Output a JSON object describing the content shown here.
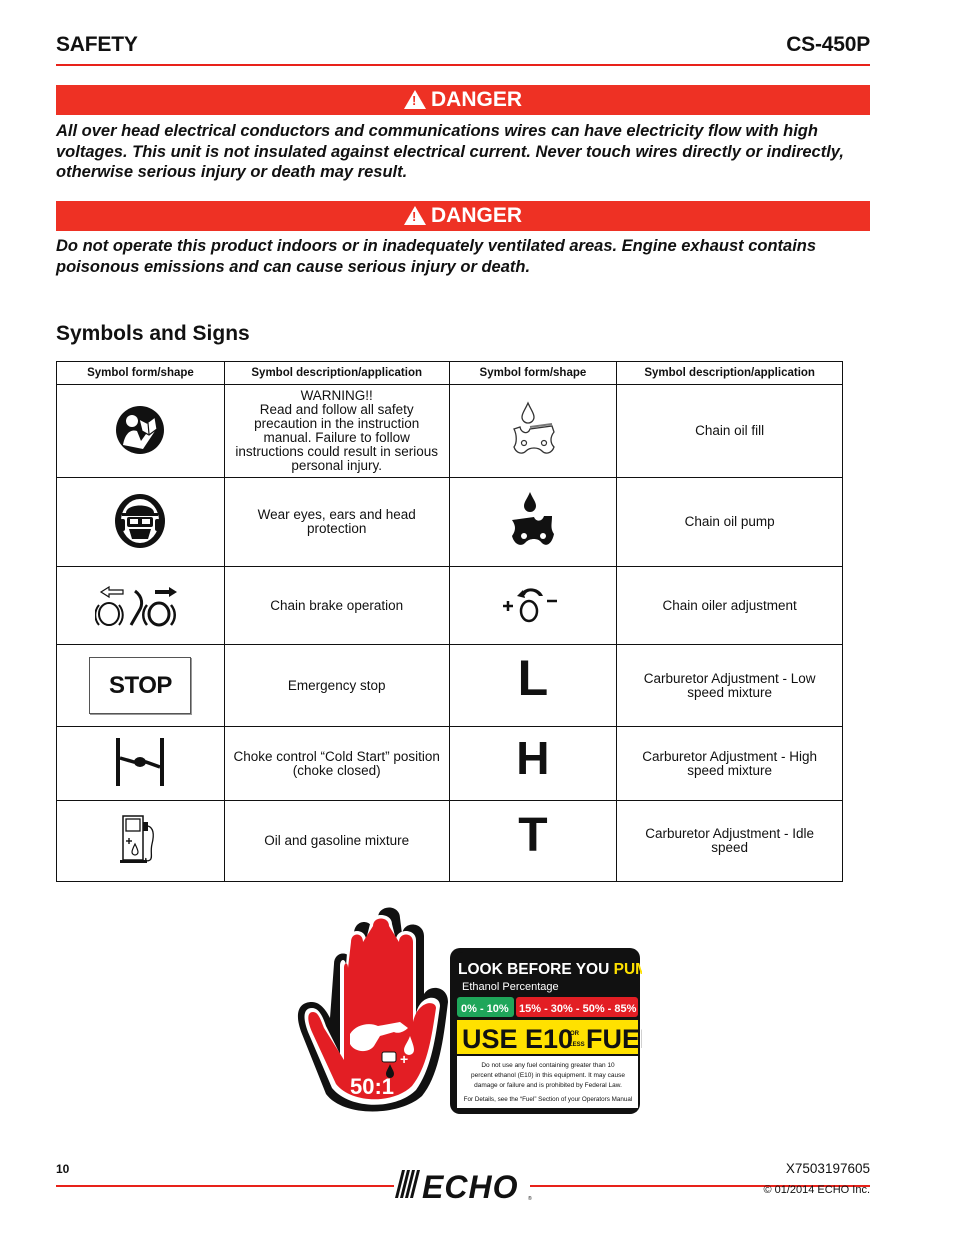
{
  "header": {
    "section": "SAFETY",
    "model": "CS-450P"
  },
  "dangers": [
    {
      "label": "DANGER",
      "text": "All over head electrical conductors and communications wires can have electricity flow with high voltages. This unit is not insulated against electrical current. Never touch wires directly or indirectly, otherwise serious injury or death may result."
    },
    {
      "label": "DANGER",
      "text": "Do not operate this product indoors or in inadequately ventilated areas. Engine exhaust contains poisonous emissions and can cause serious injury or death."
    }
  ],
  "symbols_section": {
    "title": "Symbols and Signs",
    "columns": [
      "Symbol form/shape",
      "Symbol description/application",
      "Symbol form/shape",
      "Symbol description/application"
    ],
    "rows": [
      {
        "left": {
          "icon": "read-manual-icon",
          "desc": [
            "WARNING!!",
            "Read and follow all safety",
            "precaution in the instruction",
            "manual. Failure to follow",
            "instructions could result in serious",
            "personal injury."
          ]
        },
        "right": {
          "icon": "chain-oil-fill-icon",
          "desc": [
            "Chain oil fill"
          ]
        }
      },
      {
        "left": {
          "icon": "head-protection-icon",
          "desc": [
            "Wear eyes, ears and head",
            "protection"
          ]
        },
        "right": {
          "icon": "chain-oil-pump-icon",
          "desc": [
            "Chain oil pump"
          ]
        }
      },
      {
        "left": {
          "icon": "chain-brake-icon",
          "desc": [
            "Chain brake operation"
          ]
        },
        "right": {
          "icon": "oiler-adjustment-icon",
          "desc": [
            "Chain oiler adjustment"
          ]
        }
      },
      {
        "left": {
          "icon": "stop-icon",
          "icon_text": "STOP",
          "desc": [
            "Emergency stop"
          ]
        },
        "right": {
          "icon": "letter-l-icon",
          "icon_text": "L",
          "desc": [
            "Carburetor Adjustment - Low",
            "speed mixture"
          ]
        }
      },
      {
        "left": {
          "icon": "choke-icon",
          "desc": [
            "Choke control “Cold Start” position",
            "(choke closed)"
          ]
        },
        "right": {
          "icon": "letter-h-icon",
          "icon_text": "H",
          "desc": [
            "Carburetor Adjustment - High",
            "speed mixture"
          ]
        }
      },
      {
        "left": {
          "icon": "fuel-pump-icon",
          "desc": [
            "Oil and gasoline mixture"
          ]
        },
        "right": {
          "icon": "letter-t-icon",
          "icon_text": "T",
          "desc": [
            "Carburetor Adjustment - Idle",
            "speed"
          ]
        }
      }
    ]
  },
  "fuel_label": {
    "headline_a": "LOOK BEFORE YOU",
    "headline_b": "PUMP!",
    "subhead": "Ethanol Percentage",
    "ok_range": "0% - 10%",
    "bad_range": "15% - 30% - 50% - 85%",
    "use_a": "USE E10",
    "use_or": "OR",
    "use_less": "LESS",
    "use_b": "FUEL",
    "notice": [
      "Do not use any fuel containing greater than 10",
      "percent ethanol (E10) in this equipment. It may cause",
      "damage or failure and is prohibited by Federal Law."
    ],
    "details": "For Details, see the “Fuel” Section of your Operators Manual",
    "ratio": "50:1",
    "colors": {
      "red": "#e31e24",
      "green": "#1fa65a",
      "yellow": "#ffe100",
      "black": "#000000"
    }
  },
  "footer": {
    "page": "10",
    "brand": "ECHO",
    "doc_code": "X7503197605",
    "copyright": "© 01/2014 ECHO Inc."
  },
  "colors": {
    "accent_red": "#ee3124",
    "rule_red": "#e8221a"
  }
}
